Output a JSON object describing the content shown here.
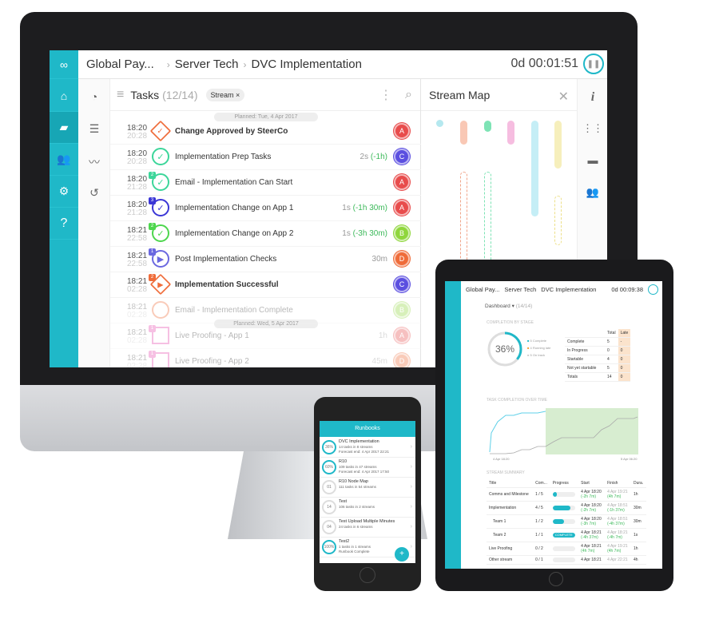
{
  "desktop": {
    "breadcrumb": [
      "Global Pay...",
      "Server Tech",
      "DVC Implementation"
    ],
    "timer": "0d 00:01:51",
    "tasks_title": "Tasks",
    "tasks_count": "(12/14)",
    "filter_chip": "Stream ×",
    "planned_1": "Planned: Tue, 4 Apr 2017",
    "planned_2": "Planned: Wed, 5 Apr 2017",
    "stream_map_title": "Stream Map",
    "accent": "#1fb8c8",
    "tasks": [
      {
        "t1": "18:20",
        "t2": "20:28",
        "title": "Change Approved by SteerCo",
        "dur": "",
        "delta": "",
        "who": "A",
        "whoColor": "#e84c4c",
        "mark": "diamond-check",
        "color": "#ef6c3a",
        "bold": true
      },
      {
        "t1": "18:20",
        "t2": "20:28",
        "title": "Implementation Prep Tasks",
        "dur": "2s",
        "delta": "(-1h)",
        "who": "C",
        "whoColor": "#5b4fe0",
        "mark": "check",
        "color": "#3cd69a"
      },
      {
        "t1": "18:20",
        "t2": "21:28",
        "title": "Email - Implementation Can Start",
        "dur": "",
        "delta": "",
        "who": "A",
        "whoColor": "#e84c4c",
        "mark": "check",
        "color": "#3cd69a",
        "badge": "2"
      },
      {
        "t1": "18:20",
        "t2": "21:28",
        "title": "Implementation Change on App 1",
        "dur": "1s",
        "delta": "(-1h 30m)",
        "who": "A",
        "whoColor": "#e84c4c",
        "mark": "check",
        "color": "#3b36d6",
        "badge": "3"
      },
      {
        "t1": "18:21",
        "t2": "22:58",
        "title": "Implementation Change on App 2",
        "dur": "1s",
        "delta": "(-3h 30m)",
        "who": "B",
        "whoColor": "#8fd63c",
        "mark": "check",
        "color": "#4dd64d",
        "badge": "2"
      },
      {
        "t1": "18:21",
        "t2": "22:58",
        "title": "Post Implementation Checks",
        "dur": "30m",
        "delta": "",
        "who": "D",
        "whoColor": "#ef6c3a",
        "mark": "play",
        "color": "#6b68e0",
        "badge": "1"
      },
      {
        "t1": "18:21",
        "t2": "02:28",
        "title": "Implementation Successful",
        "dur": "",
        "delta": "",
        "who": "C",
        "whoColor": "#5b4fe0",
        "mark": "diamond-play",
        "color": "#ef6c3a",
        "bold": true,
        "badge": "2"
      },
      {
        "t1": "18:21",
        "t2": "02:28",
        "title": "Email - Implementation Complete",
        "dur": "",
        "delta": "",
        "who": "B",
        "whoColor": "#8fd63c",
        "mark": "circle",
        "color": "#ef6c3a",
        "faded": true
      },
      {
        "t1": "18:21",
        "t2": "02:28",
        "title": "Live Proofing - App 1",
        "dur": "1h",
        "delta": "",
        "who": "A",
        "whoColor": "#e84c4c",
        "mark": "square",
        "color": "#e84cb0",
        "faded": true,
        "badge": "1"
      },
      {
        "t1": "18:21",
        "t2": "02:28",
        "title": "Live Proofing - App 2",
        "dur": "45m",
        "delta": "",
        "who": "D",
        "whoColor": "#ef6c3a",
        "mark": "square",
        "color": "#e84cb0",
        "faded": true,
        "badge": "1"
      }
    ]
  },
  "tablet": {
    "breadcrumb": [
      "Global Pay...",
      "Server Tech",
      "DVC Implementation"
    ],
    "timer": "0d 00:09:38",
    "view": "Dashboard",
    "count": "(14/14)",
    "completion_title": "COMPLETION BY STAGE",
    "percent": "36%",
    "percent_value": 36,
    "legend": [
      "5 Complete",
      "4 Running late",
      "5 On track"
    ],
    "stage_headers": [
      "",
      "Total",
      "Late"
    ],
    "stages": [
      [
        "Complete",
        "5",
        "-"
      ],
      [
        "In Progress",
        "0",
        "0"
      ],
      [
        "Startable",
        "4",
        "0"
      ],
      [
        "Not yet startable",
        "5",
        "0"
      ],
      [
        "Totals",
        "14",
        "0"
      ]
    ],
    "chart_title": "TASK COMPLETION OVER TIME",
    "x_start": "4 Apr 18:20",
    "x_end": "5 Apr 06:20",
    "summary_title": "STREAM SUMMARY",
    "summary_headers": [
      "Title",
      "Com...",
      "Progress",
      "Start",
      "Finish",
      "Dura."
    ],
    "summary": [
      {
        "title": "Comms and Milestone",
        "com": "1 / 5",
        "progress": 20,
        "start": "4 Apr 18:20",
        "sd": "(-2h 7m)",
        "finish": "4 Apr 19:21",
        "fd": "(4h 7m)",
        "dur": "1h"
      },
      {
        "title": "Implementation",
        "com": "4 / 5",
        "progress": 80,
        "start": "4 Apr 18:20",
        "sd": "(-2h 7m)",
        "finish": "4 Apr 18:51",
        "fd": "(-1h 37m)",
        "dur": "30m"
      },
      {
        "title": "Team 1",
        "com": "1 / 2",
        "progress": 50,
        "start": "4 Apr 18:20",
        "sd": "(-3h 7m)",
        "finish": "4 Apr 18:51",
        "fd": "(-4h 37m)",
        "dur": "30m"
      },
      {
        "title": "Team 2",
        "com": "1 / 1",
        "progress": 100,
        "label": "COMPLETE",
        "start": "4 Apr 18:21",
        "sd": "(-4h 37m)",
        "finish": "4 Apr 18:21",
        "fd": "(-4h 7m)",
        "dur": "1s"
      },
      {
        "title": "Live Proofing",
        "com": "0 / 2",
        "progress": 0,
        "start": "4 Apr 18:21",
        "sd": "(4h 7m)",
        "finish": "4 Apr 19:21",
        "fd": "(4h 7m)",
        "dur": "1h"
      },
      {
        "title": "Other stream",
        "com": "0 / 1",
        "progress": 0,
        "start": "4 Apr 18:21",
        "sd": "",
        "finish": "4 Apr 22:21",
        "fd": "",
        "dur": "4h"
      }
    ]
  },
  "phone": {
    "title": "Runbooks",
    "items": [
      {
        "c": "36%",
        "name": "DVC Implementation",
        "l1": "14 tasks in 8 streams",
        "l2": "Forecast end: 4 Apr 2017 22:21",
        "p": 36
      },
      {
        "c": "60%",
        "name": "R10",
        "l1": "109 tasks in 47 streams",
        "l2": "Forecast end: 4 Apr 2017 17:50",
        "p": 60
      },
      {
        "c": "01",
        "name": "R10 Node Map",
        "l1": "111 tasks in 54 streams",
        "l2": "",
        "p": 0
      },
      {
        "c": "14",
        "name": "Test",
        "l1": "106 tasks in 2 streams",
        "l2": "",
        "p": 0
      },
      {
        "c": "04",
        "name": "Test Upload Multiple Minutes",
        "l1": "24 tasks in 6 streams",
        "l2": "",
        "p": 0
      },
      {
        "c": "100%",
        "name": "Test2",
        "l1": "1 tasks in 1 streams",
        "l2": "Runbook Complete",
        "p": 100
      }
    ],
    "fab": "+"
  }
}
